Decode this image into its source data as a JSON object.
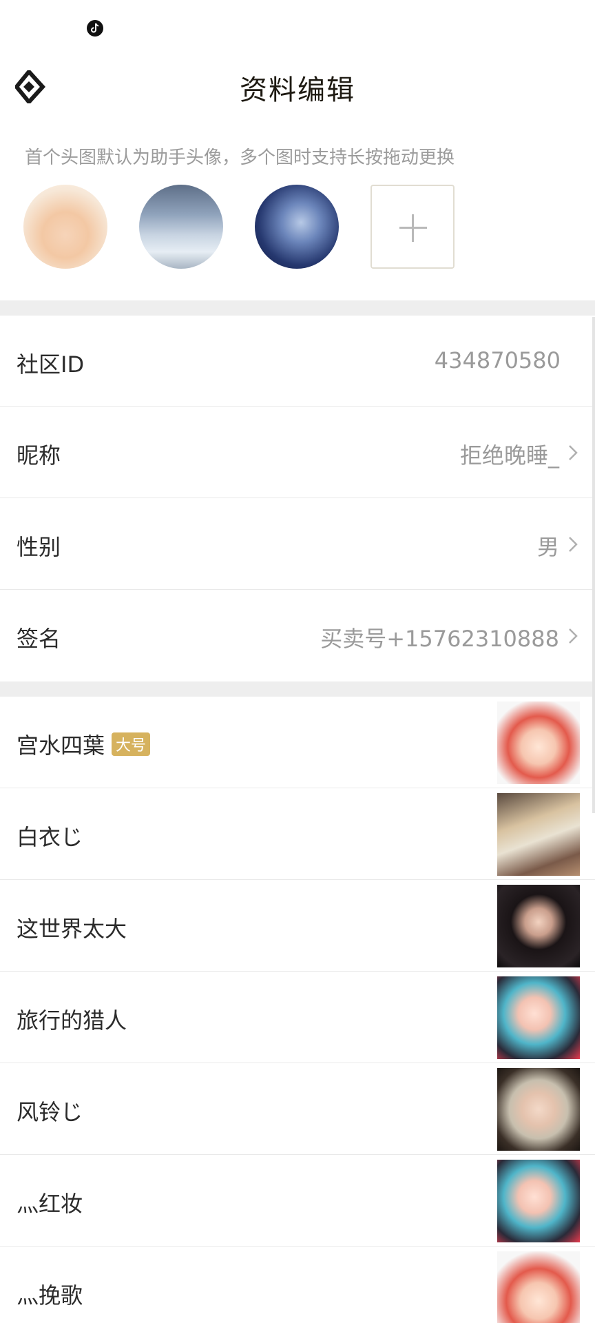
{
  "header": {
    "title": "资料编辑"
  },
  "photos": {
    "hint": "首个头图默认为助手头像，多个图时支持长按拖动更换",
    "add_label": "+"
  },
  "profile": {
    "community_id": {
      "label": "社区ID",
      "value": "434870580"
    },
    "nickname": {
      "label": "昵称",
      "value": "拒绝晚睡_"
    },
    "gender": {
      "label": "性别",
      "value": "男"
    },
    "signature": {
      "label": "签名",
      "value": "买卖号+15762310888"
    }
  },
  "characters": [
    {
      "name": "宫水四葉",
      "badge": "大号"
    },
    {
      "name": "白衣じ"
    },
    {
      "name": "这世界太大"
    },
    {
      "name": "旅行的猎人"
    },
    {
      "name": "风铃じ"
    },
    {
      "name": "灬红妆"
    },
    {
      "name": "灬挽歌"
    }
  ],
  "colors": {
    "badge": "#d6b25e",
    "divider": "#eeeeee",
    "value_text": "#9a9a9a"
  },
  "icons": {
    "back": "diamond-back-icon",
    "status": "tiktok-icon",
    "row_arrow": "chevron-right-icon"
  }
}
